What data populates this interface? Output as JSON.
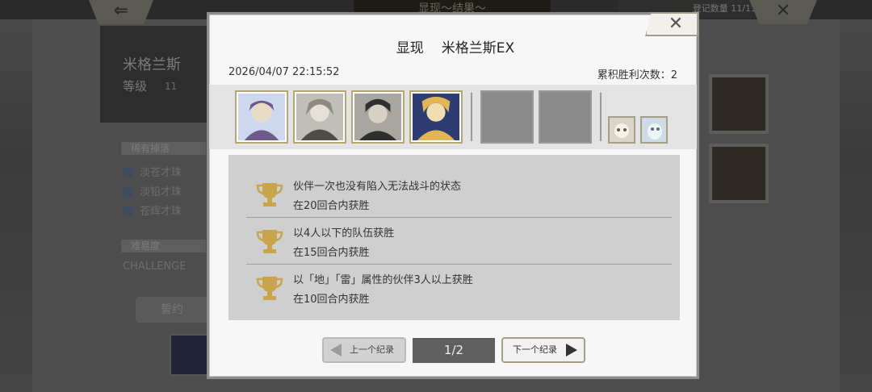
{
  "background": {
    "back_icon": "back-arrow-icon",
    "title": "显现～结果～",
    "record_count": "登记数量 11/11",
    "close_icon": "close-x-icon",
    "character_name": "米格兰斯",
    "level_label": "等级",
    "level_value": "11",
    "section_rare": "稀有掉落",
    "items": [
      "淡苍才珠",
      "淡铅才珠",
      "苍辉才珠"
    ],
    "section_difficulty": "难易度",
    "difficulty": "CHALLENGE",
    "pledge_button": "誓约"
  },
  "modal": {
    "title_prefix": "显现",
    "title_name": "米格兰斯EX",
    "close_icon": "close-x-icon",
    "date": "2026/04/07 22:15:52",
    "wins_label": "累积胜利次数：2",
    "party": [
      {
        "slot": "portrait-1",
        "colors": [
          "#cdd7ee",
          "#6d5a8c",
          "#e9dcc7"
        ]
      },
      {
        "slot": "portrait-2",
        "colors": [
          "#bfbfb8",
          "#4f4b45",
          "#8d8a80"
        ]
      },
      {
        "slot": "portrait-3",
        "colors": [
          "#a8a6a0",
          "#2f2f2f",
          "#d8d2c4"
        ]
      },
      {
        "slot": "portrait-4",
        "colors": [
          "#2d3d73",
          "#e2b655",
          "#f1ddb4"
        ]
      }
    ],
    "empty_slots": 2,
    "pets": [
      {
        "slot": "pet-1",
        "colors": [
          "#d9d6c9",
          "#6b5a3e"
        ]
      },
      {
        "slot": "pet-2",
        "colors": [
          "#cfdbe6",
          "#5d6d7d"
        ]
      }
    ],
    "missions": [
      {
        "line1": "伙伴一次也没有陷入无法战斗的状态",
        "line2": "在20回合内获胜",
        "icon": "trophy-icon"
      },
      {
        "line1": "以4人以下的队伍获胜",
        "line2": "在15回合内获胜",
        "icon": "trophy-icon"
      },
      {
        "line1": "以「地」「雷」属性的伙伴3人以上获胜",
        "line2": "在10回合内获胜",
        "icon": "trophy-icon"
      }
    ],
    "prev_label": "上一个纪录",
    "page": "1/2",
    "next_label": "下一个纪录",
    "trophy_color": "#c8a44a"
  }
}
